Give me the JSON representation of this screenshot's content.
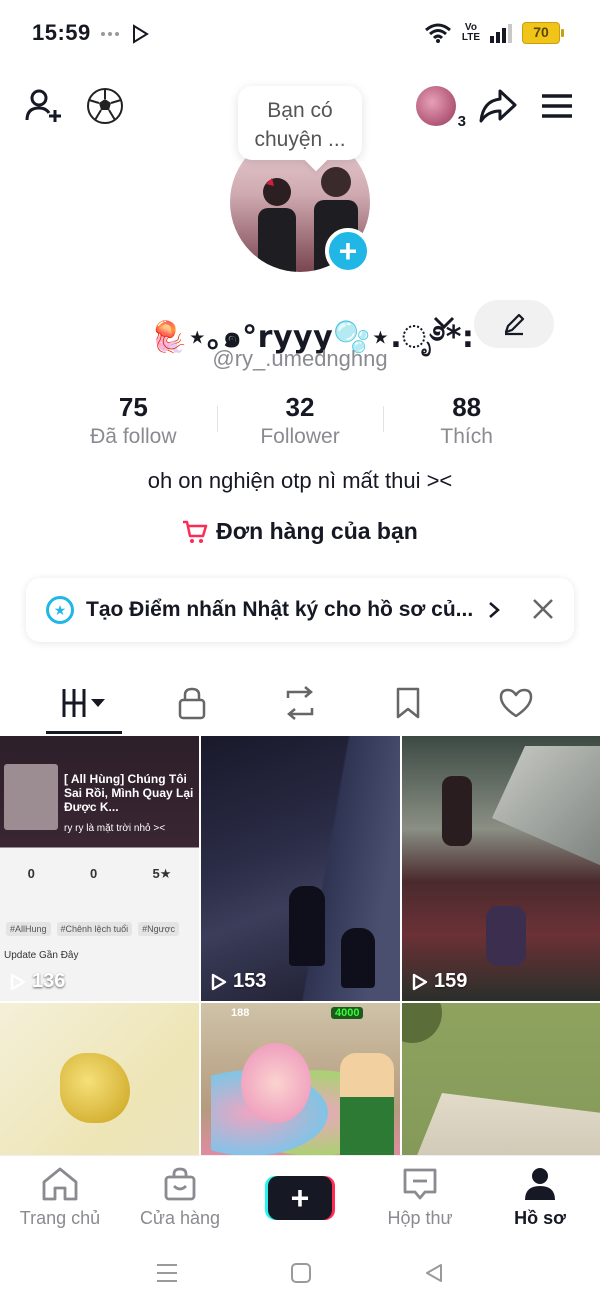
{
  "status_bar": {
    "time": "15:59",
    "network_label_top": "Vo",
    "network_label_bottom": "LTE",
    "battery": "70"
  },
  "profile": {
    "note": "Bạn có chuyện ...",
    "story_count": "3",
    "display_name": "🪼⋆｡๑°ryyy🫧⋆.ೃ࿔*:･",
    "username": "@ry_.umednghng",
    "stats": [
      {
        "value": "75",
        "label": "Đã follow"
      },
      {
        "value": "32",
        "label": "Follower"
      },
      {
        "value": "88",
        "label": "Thích"
      }
    ],
    "bio": "oh on nghiện otp nì mất thui ><",
    "orders_label": "Đơn hàng của bạn"
  },
  "banner": {
    "text": "Tạo Điểm nhấn Nhật ký cho hồ sơ củ..."
  },
  "videos": [
    {
      "views": "136",
      "title": "[ All Hùng] Chúng Tôi Sai Rồi, Mình Quay Lại Được K...",
      "caption": "ry ry là mặt trời nhỏ ><",
      "stat_values": [
        "0",
        "0",
        "5★"
      ],
      "tags": [
        "#AllHung",
        "#Chênh lệch tuổi",
        "#Ngược"
      ],
      "update_text": "Update Gần Đây"
    },
    {
      "views": "153"
    },
    {
      "views": "159"
    },
    {
      "views": ""
    },
    {
      "views": "",
      "hud_left": "188",
      "hud_right": "4000"
    },
    {
      "views": ""
    }
  ],
  "bottom_nav": [
    {
      "label": "Trang chủ"
    },
    {
      "label": "Cửa hàng"
    },
    {
      "label": "Hộp thư"
    },
    {
      "label": "Hồ sơ"
    }
  ],
  "colors": {
    "accent_cyan": "#20b7e6",
    "tiktok_red": "#fe2c55",
    "tiktok_cyan": "#25f4ee",
    "battery": "#f0c419"
  }
}
